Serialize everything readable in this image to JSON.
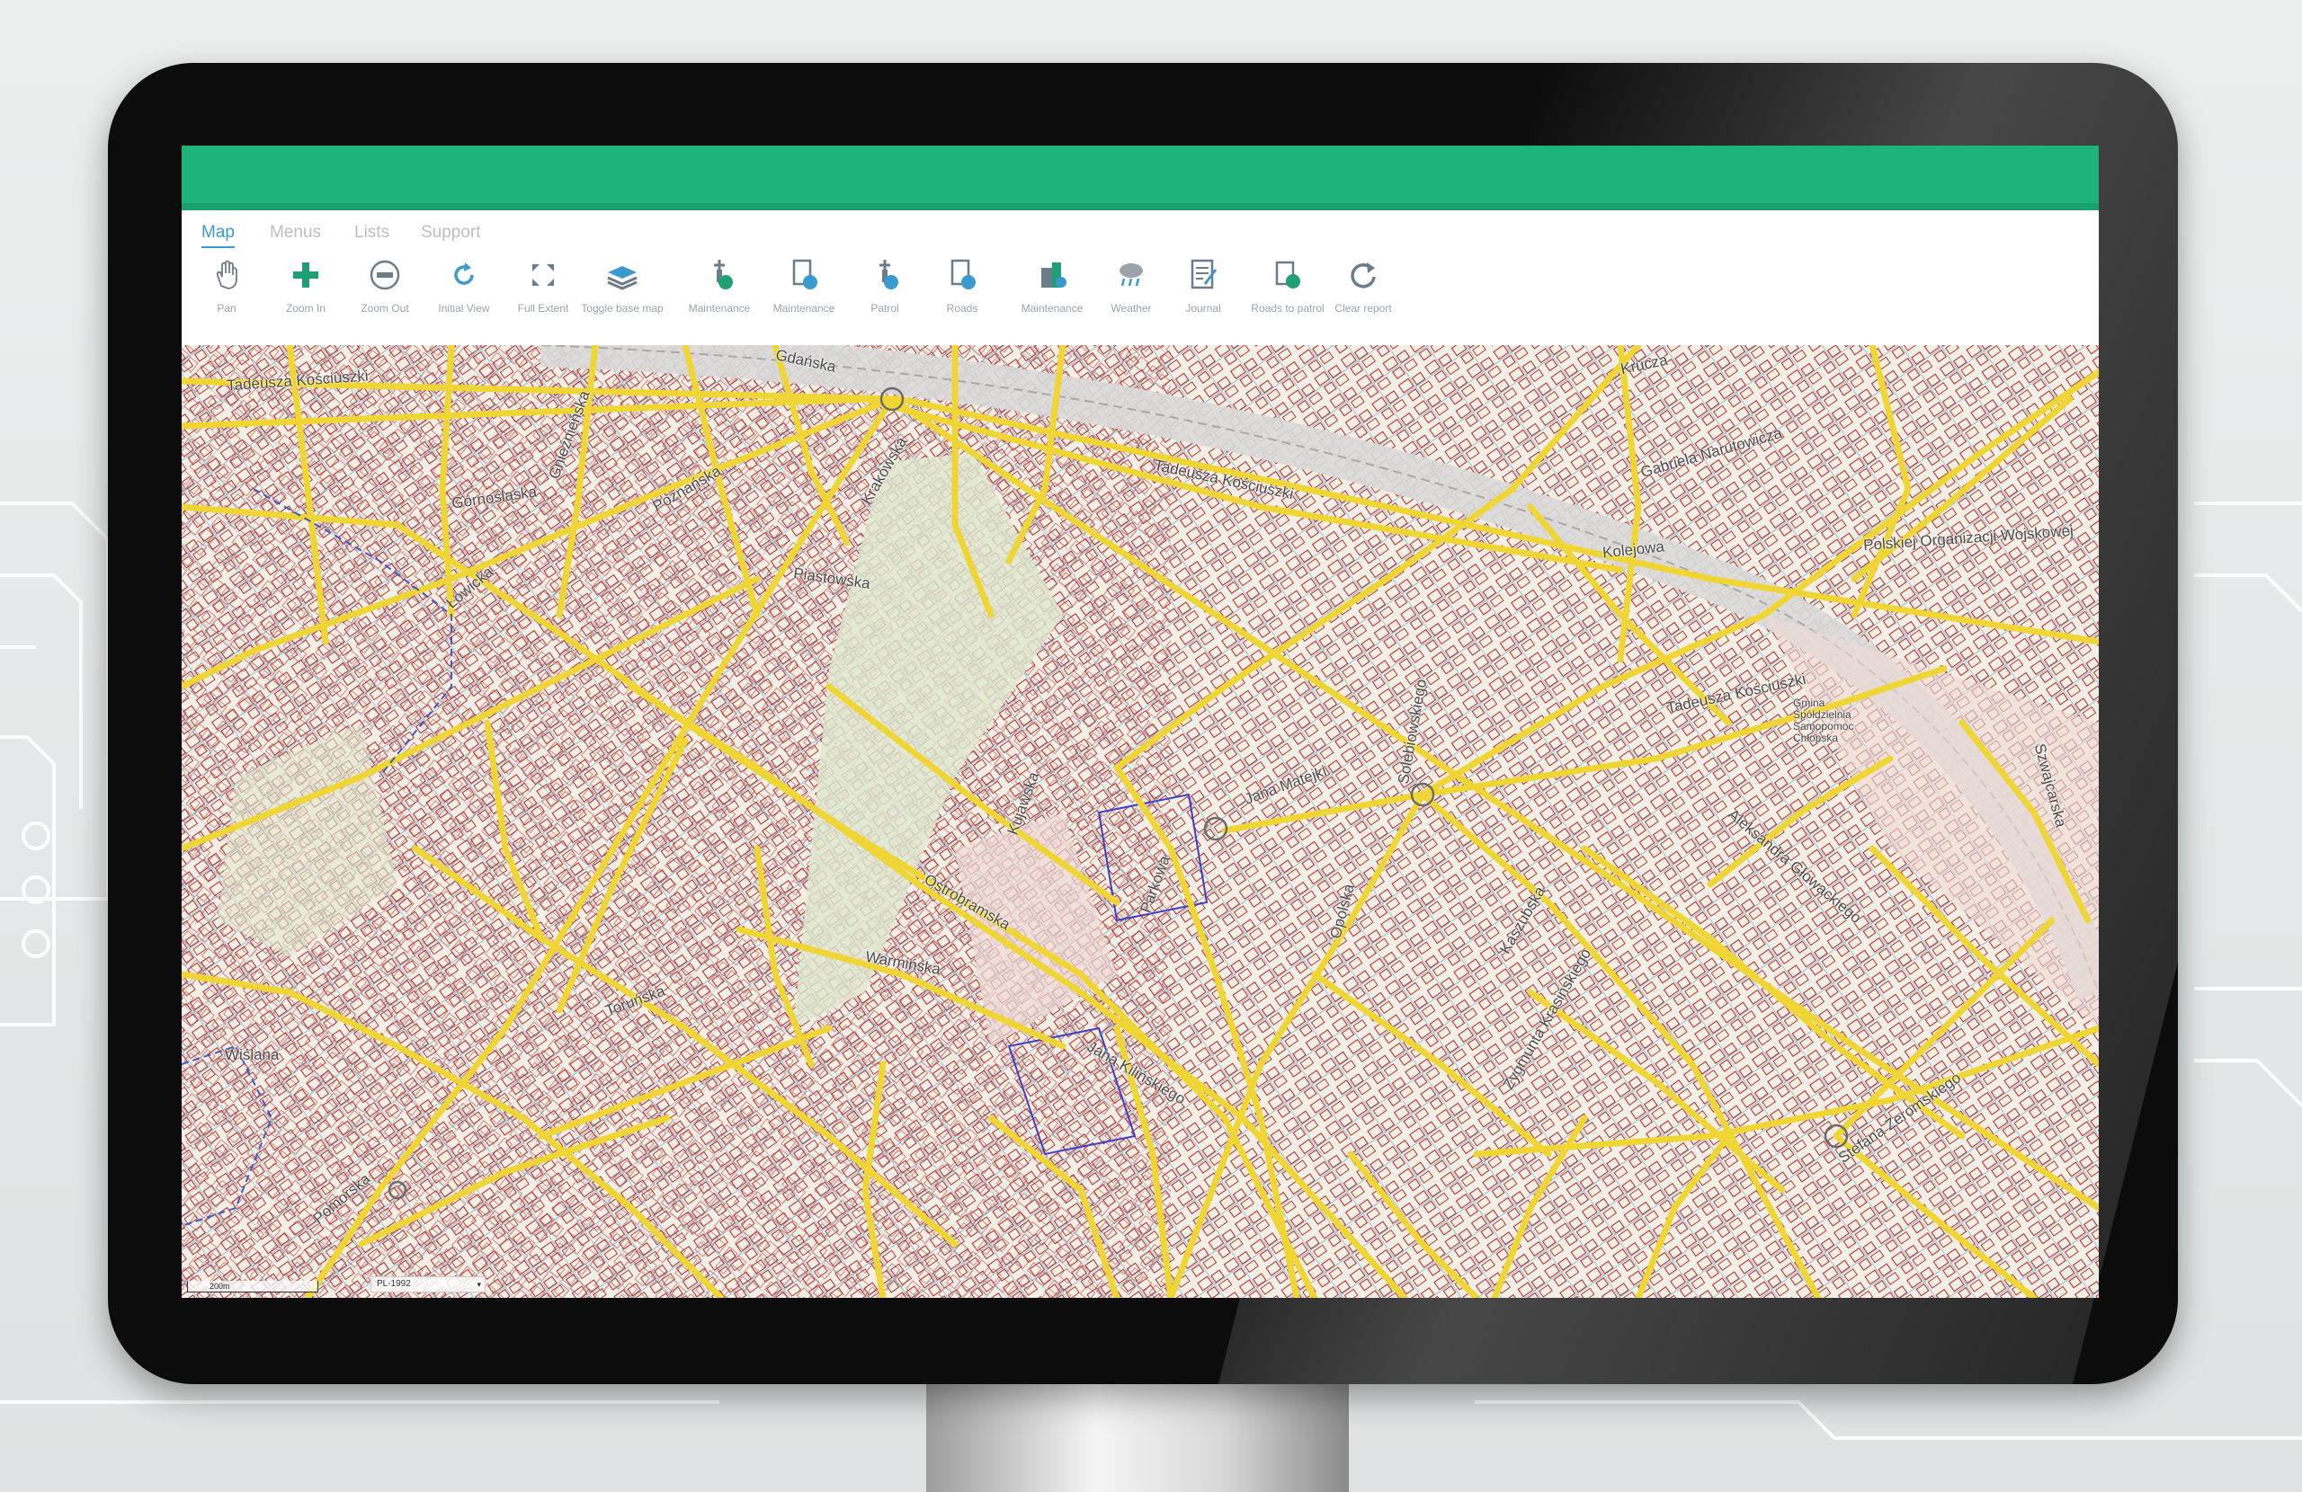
{
  "tabs": [
    "Map",
    "Menus",
    "Lists",
    "Support"
  ],
  "toolbar": [
    {
      "label": "Pan",
      "icon": "pan-icon"
    },
    {
      "label": "Zoom In",
      "icon": "zoom-in-icon"
    },
    {
      "label": "Zoom Out",
      "icon": "zoom-out-icon"
    },
    {
      "label": "Initial View",
      "icon": "initial-view-icon"
    },
    {
      "label": "Full Extent",
      "icon": "full-extent-icon"
    },
    {
      "label": "Toggle base map",
      "icon": "layers-icon"
    },
    {
      "label": "Maintenance",
      "icon": "maintenance-pin-icon"
    },
    {
      "label": "Maintenance",
      "icon": "maintenance-doc-icon"
    },
    {
      "label": "Patrol",
      "icon": "patrol-icon"
    },
    {
      "label": "Roads",
      "icon": "roads-icon"
    },
    {
      "label": "Maintenance",
      "icon": "maintenance-building-icon"
    },
    {
      "label": "Weather",
      "icon": "weather-icon"
    },
    {
      "label": "Journal",
      "icon": "journal-icon"
    },
    {
      "label": "Roads to patrol",
      "icon": "roads-to-patrol-icon"
    },
    {
      "label": "Clear report",
      "icon": "refresh-icon"
    }
  ],
  "map": {
    "streets": [
      "Tadeusza Kościuszki",
      "Gdańska",
      "Górnośląska",
      "Poznańska",
      "Krakowska",
      "Piastowska",
      "Gnieźnieńska",
      "Tadeusza Kościuszki",
      "Kolejowa",
      "Gabriela Narutowicza",
      "Polskiej Organizacji Wojskowej",
      "Kruczа",
      "Tadeusza Kościuszki",
      "Łowicka",
      "Kujawska",
      "Warmińska",
      "Ostrobramska",
      "Wiślana",
      "Pomorska",
      "Jana Matejki",
      "Parkowa",
      "Solebiowskiego",
      "Szwajcarska",
      "Jana Kilińskiego",
      "Zygmunta Krasińskiego",
      "Aleksandra Głowackiego",
      "Stefana Żeromskiego",
      "Kaszubska",
      "Opolska",
      "Toruńska"
    ],
    "poi": [
      "Gmina",
      "Spółdzielnia",
      "Samopomoc",
      "Chłopska"
    ],
    "scale": "200m",
    "crs": "PL-1992"
  },
  "colors": {
    "accent_green": "#1fb37c",
    "tab_active": "#3a9ad0",
    "road": "#efd635",
    "parcel": "#b8332f",
    "utility": "#8fbfd8"
  }
}
